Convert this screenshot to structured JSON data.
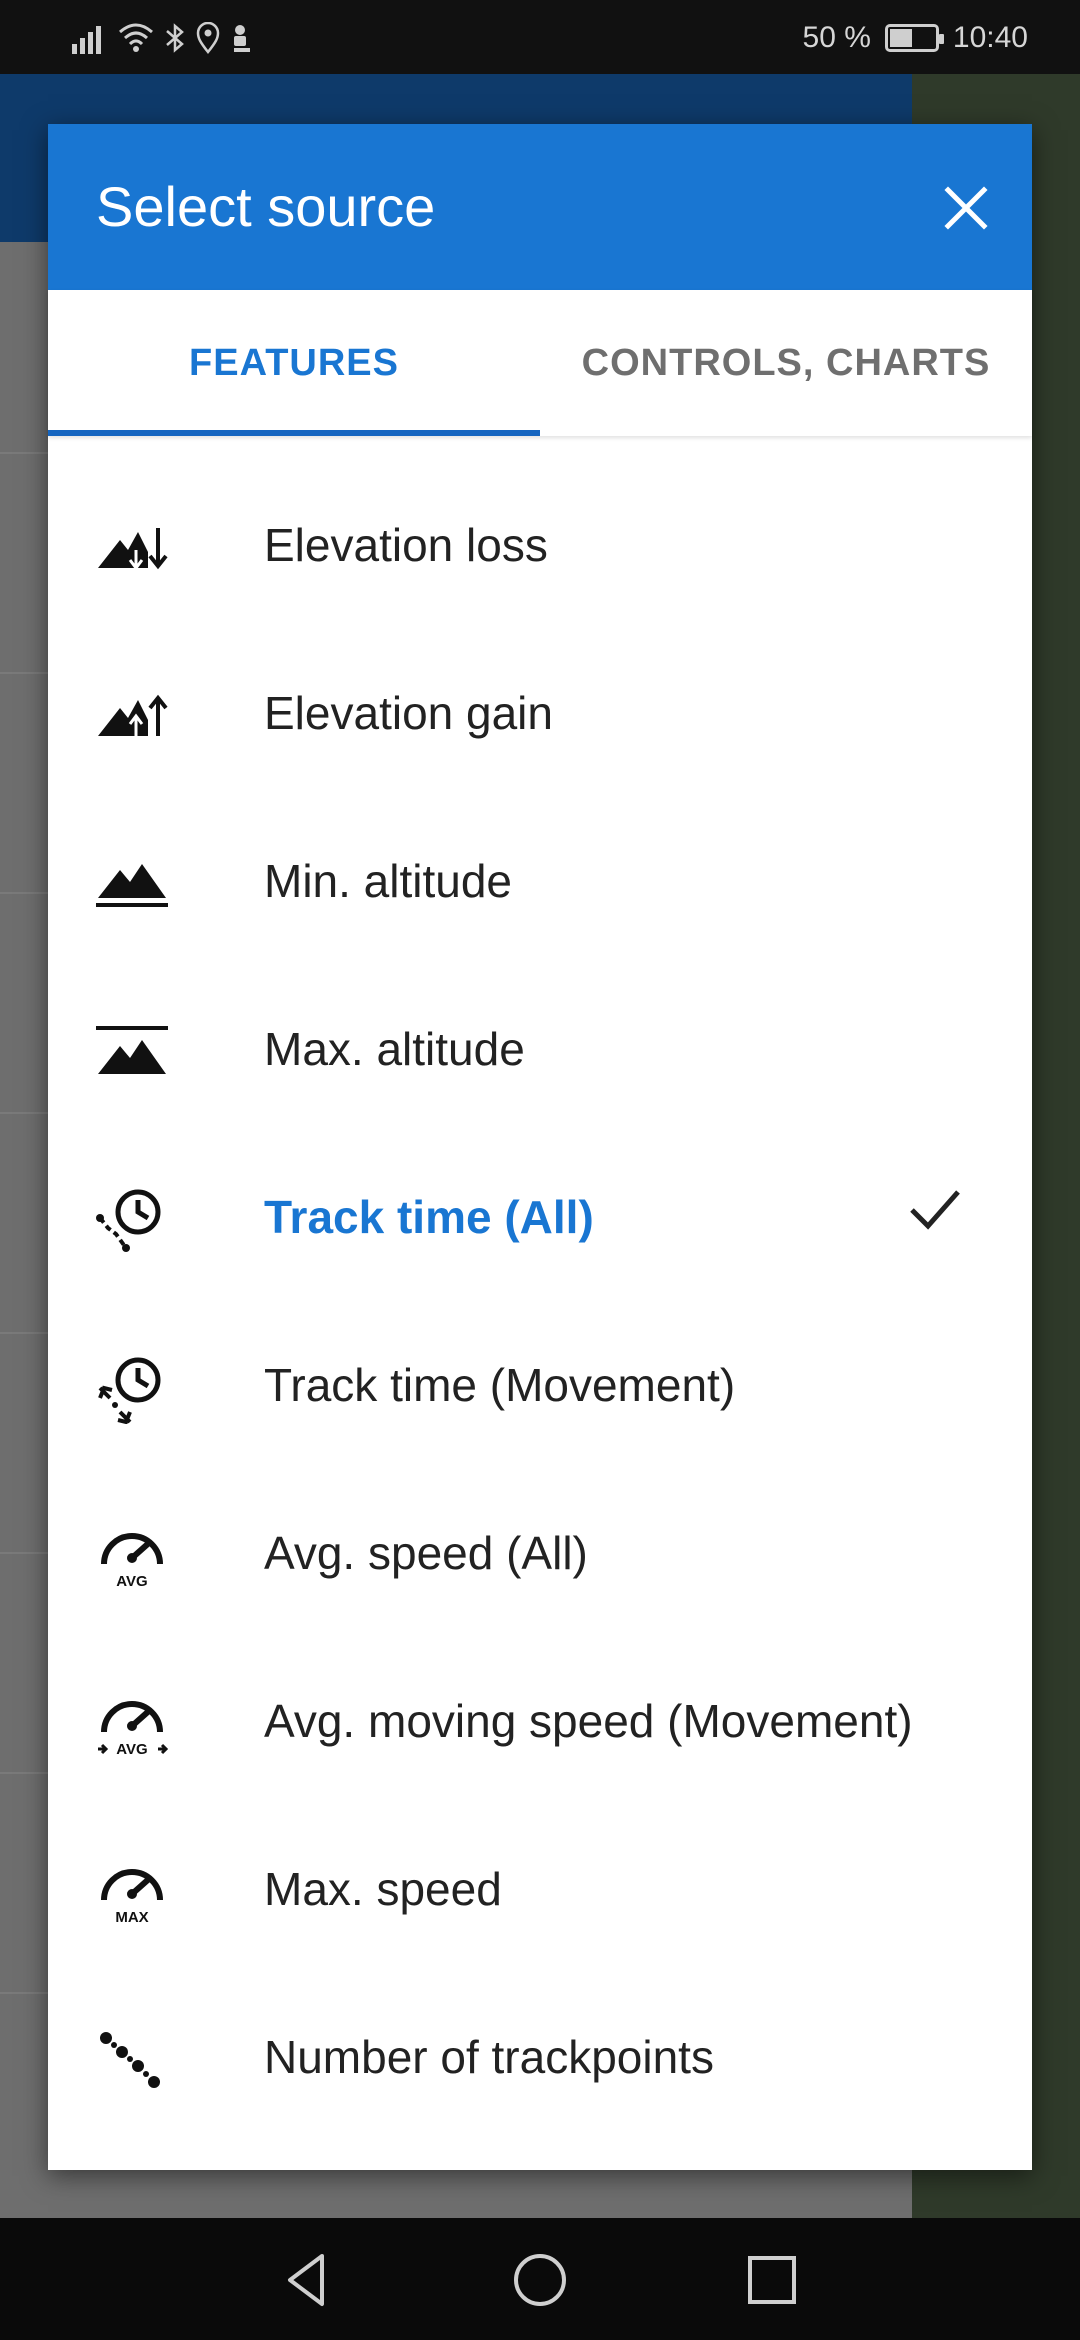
{
  "status_bar": {
    "battery_percent_text": "50 %",
    "battery_level": 0.5,
    "time": "10:40",
    "icons": [
      "signal-icon",
      "wifi-icon",
      "bluetooth-icon",
      "location-icon",
      "recording-icon"
    ]
  },
  "dialog": {
    "title": "Select source",
    "close_icon": "close-icon",
    "accent_color": "#1976d2",
    "tabs": [
      {
        "label": "FEATURES",
        "active": true
      },
      {
        "label": "CONTROLS, CHARTS",
        "active": false
      }
    ],
    "items": [
      {
        "label": "Elevation loss",
        "icon": "elevation-loss-icon",
        "selected": false
      },
      {
        "label": "Elevation gain",
        "icon": "elevation-gain-icon",
        "selected": false
      },
      {
        "label": "Min. altitude",
        "icon": "min-altitude-icon",
        "selected": false
      },
      {
        "label": "Max. altitude",
        "icon": "max-altitude-icon",
        "selected": false
      },
      {
        "label": "Track time (All)",
        "icon": "track-time-all-icon",
        "selected": true
      },
      {
        "label": "Track time (Movement)",
        "icon": "track-time-movement-icon",
        "selected": false
      },
      {
        "label": "Avg. speed (All)",
        "icon": "avg-speed-icon",
        "selected": false,
        "icon_text": "AVG"
      },
      {
        "label": "Avg. moving speed (Movement)",
        "icon": "avg-moving-speed-icon",
        "selected": false,
        "icon_text": "AVG"
      },
      {
        "label": "Max. speed",
        "icon": "max-speed-icon",
        "selected": false,
        "icon_text": "MAX"
      },
      {
        "label": "Number of trackpoints",
        "icon": "trackpoints-icon",
        "selected": false
      }
    ]
  },
  "nav_bar": {
    "buttons": [
      "back-icon",
      "home-icon",
      "recents-icon"
    ]
  }
}
